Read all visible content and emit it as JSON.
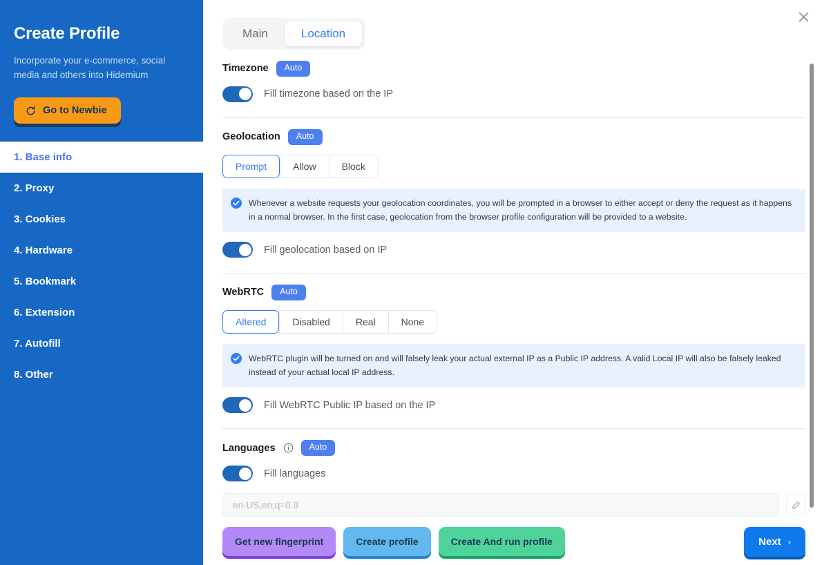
{
  "sidebar": {
    "title": "Create Profile",
    "subtitle": "Incorporate your e-commerce, social media and others into Hidemium",
    "newbie_button": "Go to Newbie",
    "items": [
      {
        "label": "1. Base info",
        "active": true
      },
      {
        "label": "2. Proxy",
        "active": false
      },
      {
        "label": "3. Cookies",
        "active": false
      },
      {
        "label": "4. Hardware",
        "active": false
      },
      {
        "label": "5. Bookmark",
        "active": false
      },
      {
        "label": "6. Extension",
        "active": false
      },
      {
        "label": "7. Autofill",
        "active": false
      },
      {
        "label": "8. Other",
        "active": false
      }
    ]
  },
  "tabs": [
    {
      "label": "Main",
      "active": false
    },
    {
      "label": "Location",
      "active": true
    }
  ],
  "sections": {
    "timezone": {
      "label": "Timezone",
      "badge": "Auto",
      "toggle_label": "Fill timezone based on the IP",
      "toggle_on": true
    },
    "geolocation": {
      "label": "Geolocation",
      "badge": "Auto",
      "options": [
        "Prompt",
        "Allow",
        "Block"
      ],
      "selected": "Prompt",
      "banner": "Whenever a website requests your geolocation coordinates, you will be prompted in a browser to either accept or deny the request as it happens in a normal browser. In the first case, geolocation from the browser profile configuration will be provided to a website.",
      "toggle_label": "Fill geolocation based on IP",
      "toggle_on": true
    },
    "webrtc": {
      "label": "WebRTC",
      "badge": "Auto",
      "options": [
        "Altered",
        "Disabled",
        "Real",
        "None"
      ],
      "selected": "Altered",
      "banner": "WebRTC plugin will be turned on and will falsely leak your actual external IP as a Public IP address. A valid Local IP will also be falsely leaked instead of your actual local IP address.",
      "toggle_label": "Fill WebRTC Public IP based on the IP",
      "toggle_on": true
    },
    "languages": {
      "label": "Languages",
      "badge": "Auto",
      "toggle_label": "Fill languages",
      "toggle_on": true,
      "input_value": "en-US,en;q=0.9"
    }
  },
  "footer": {
    "get_fingerprint": "Get new fingerprint",
    "create_profile": "Create profile",
    "create_and_run": "Create And run profile",
    "next": "Next",
    "next_chevron": "›"
  },
  "colors": {
    "sidebar_bg": "#1668c4",
    "accent_blue": "#2f7df6",
    "badge_blue": "#4d7ff0",
    "orange": "#f99a16",
    "toggle_on": "#1f67b9",
    "banner_bg": "#e9f1fe",
    "purple_btn": "#b388f7",
    "blue_btn": "#63b8f0",
    "green_btn": "#4fd39b",
    "next_btn": "#0f7aeb"
  }
}
